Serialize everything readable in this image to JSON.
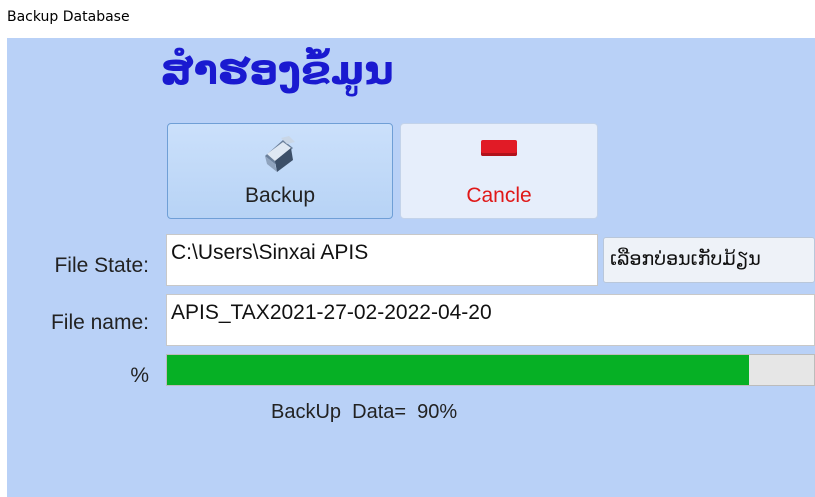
{
  "window": {
    "title": "Backup Database"
  },
  "header": {
    "title": "ສຳຮອງຂໍ້ມູນ"
  },
  "buttons": {
    "backup": {
      "label": "Backup",
      "icon": "backup-icon"
    },
    "cancel": {
      "label": "Cancle",
      "icon": "cancel-icon"
    },
    "browse": {
      "label": "ເລືອກບ່ອນເກັບມ້ຽນ"
    }
  },
  "form": {
    "file_state_label": "File State:",
    "file_state_value": "C:\\Users\\Sinxai  APIS",
    "file_name_label": "File name:",
    "file_name_value": "APIS_TAX2021-27-02-2022-04-20",
    "percent_label": "%"
  },
  "progress": {
    "percent": 90
  },
  "status": {
    "text": "BackUp  Data=  90%"
  },
  "colors": {
    "client_bg": "#b9d1f7",
    "title_blue": "#1a1ad0",
    "progress_green": "#06b025",
    "cancel_red": "#e01818"
  }
}
